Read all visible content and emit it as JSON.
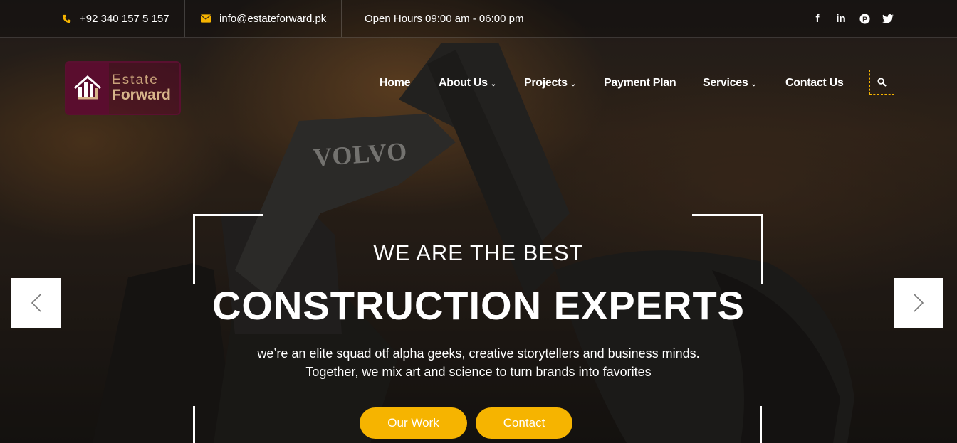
{
  "topbar": {
    "phone": "+92 340 157 5 157",
    "email": "info@estateforward.pk",
    "hours": "Open Hours 09:00 am - 06:00 pm",
    "social": [
      {
        "icon": "facebook-icon",
        "label": "f"
      },
      {
        "icon": "linkedin-icon",
        "label": "in"
      },
      {
        "icon": "pinterest-icon",
        "label": "P"
      },
      {
        "icon": "twitter-icon",
        "label": "t"
      }
    ]
  },
  "logo": {
    "line1": "Estate",
    "line2": "Forward"
  },
  "nav": {
    "home": "Home",
    "about": "About Us",
    "projects": "Projects",
    "payment": "Payment Plan",
    "services": "Services",
    "contact": "Contact Us"
  },
  "hero": {
    "kicker": "WE ARE THE BEST",
    "title": "CONSTRUCTION EXPERTS",
    "sub_line1": "we’re an elite squad otf alpha geeks, creative storytellers and business minds.",
    "sub_line2": "Together, we mix art and science to turn brands into favorites",
    "machine_text": "VOLVO"
  },
  "buttons": {
    "work": "Our Work",
    "contact": "Contact"
  },
  "colors": {
    "accent": "#f6b400",
    "brand": "#5a0d2e"
  }
}
